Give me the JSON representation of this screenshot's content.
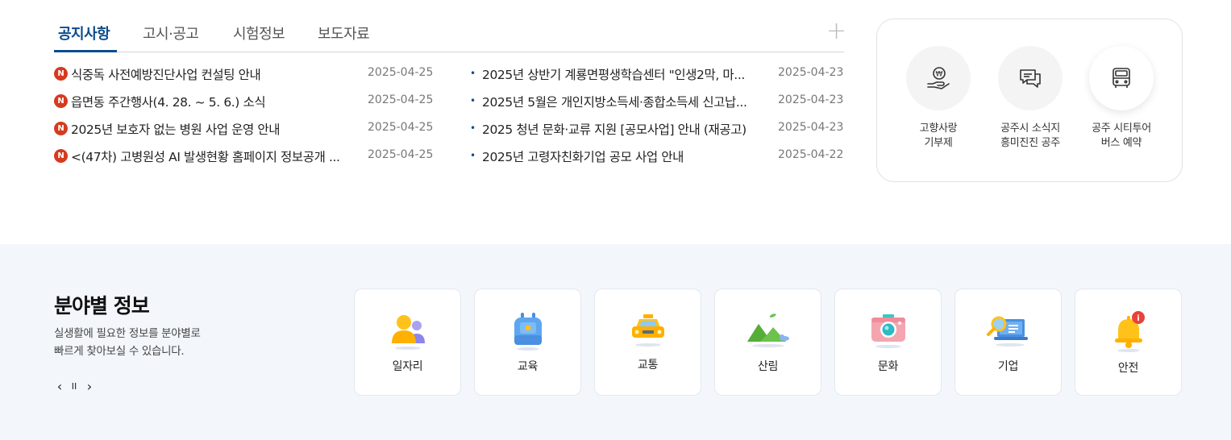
{
  "notice": {
    "tabs": [
      {
        "label": "공지사항"
      },
      {
        "label": "고시·공고"
      },
      {
        "label": "시험정보"
      },
      {
        "label": "보도자료"
      }
    ],
    "more_symbol": "+",
    "left_items": [
      {
        "badge": "N",
        "title": "식중독 사전예방진단사업 컨설팅 안내",
        "date": "2025-04-25"
      },
      {
        "badge": "N",
        "title": "읍면동 주간행사(4. 28. ~ 5. 6.) 소식",
        "date": "2025-04-25"
      },
      {
        "badge": "N",
        "title": "2025년 보호자 없는 병원 사업 운영 안내",
        "date": "2025-04-25"
      },
      {
        "badge": "N",
        "title": "<(47차) 고병원성 AI 발생현황 홈페이지 정보공개 ...",
        "date": "2025-04-25"
      }
    ],
    "right_items": [
      {
        "bullet": "•",
        "title": "2025년 상반기 계룡면평생학습센터 \"인생2막, 마...",
        "date": "2025-04-23"
      },
      {
        "bullet": "•",
        "title": "2025년 5월은 개인지방소득세·종합소득세 신고납...",
        "date": "2025-04-23"
      },
      {
        "bullet": "•",
        "title": "2025 청년 문화·교류 지원 [공모사업] 안내 (재공고)",
        "date": "2025-04-23"
      },
      {
        "bullet": "•",
        "title": "2025년 고령자친화기업 공모 사업 안내",
        "date": "2025-04-22"
      }
    ]
  },
  "quick_links": [
    {
      "label": "고향사랑\n기부제",
      "icon": "hand-coin-icon"
    },
    {
      "label": "공주시 소식지\n흥미진진 공주",
      "icon": "chat-bubbles-icon"
    },
    {
      "label": "공주 시티투어\n버스 예약",
      "icon": "bus-icon"
    }
  ],
  "field_info": {
    "title": "분야별 정보",
    "description": "실생활에 필요한 정보를 분야별로\n빠르게 찾아보실 수 있습니다.",
    "controls": {
      "prev": "‹",
      "pause": "II",
      "next": "›"
    },
    "categories": [
      {
        "label": "일자리",
        "icon": "people-icon"
      },
      {
        "label": "교육",
        "icon": "backpack-icon"
      },
      {
        "label": "교통",
        "icon": "taxi-icon"
      },
      {
        "label": "산림",
        "icon": "mountain-icon"
      },
      {
        "label": "문화",
        "icon": "camera-icon"
      },
      {
        "label": "기업",
        "icon": "laptop-search-icon"
      },
      {
        "label": "안전",
        "icon": "bell-icon"
      }
    ]
  },
  "colors": {
    "accent": "#0b4c8c",
    "new_badge": "#d63b1f",
    "section_bg": "#f3f7fc"
  }
}
